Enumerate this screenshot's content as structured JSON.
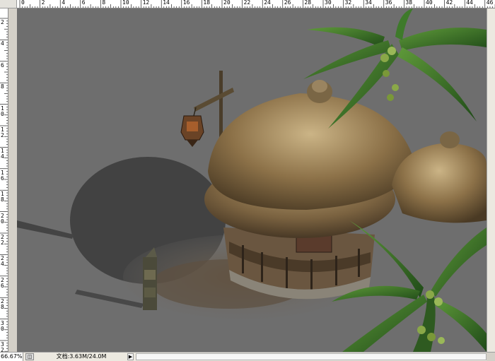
{
  "rulers": {
    "top_labels": [
      "0",
      "2",
      "4",
      "6",
      "8",
      "10",
      "12",
      "14",
      "16",
      "18",
      "20",
      "22",
      "24",
      "26",
      "28",
      "30",
      "32",
      "34",
      "36",
      "38",
      "40",
      "42",
      "44",
      "46"
    ],
    "left_labels": [
      "2",
      "4",
      "6",
      "8",
      "10",
      "12",
      "14",
      "16",
      "18",
      "20",
      "22",
      "24",
      "26",
      "28",
      "30",
      "32"
    ]
  },
  "status_bar": {
    "zoom": "66.67%",
    "doc_info": "文档:3.63M/24.0M",
    "nav_icon": "navigator-icon",
    "menu_arrow": "▶"
  },
  "colors": {
    "canvas": "#6e6e6e",
    "ruler": "#ffffff",
    "chrome": "#d4d0c8"
  }
}
